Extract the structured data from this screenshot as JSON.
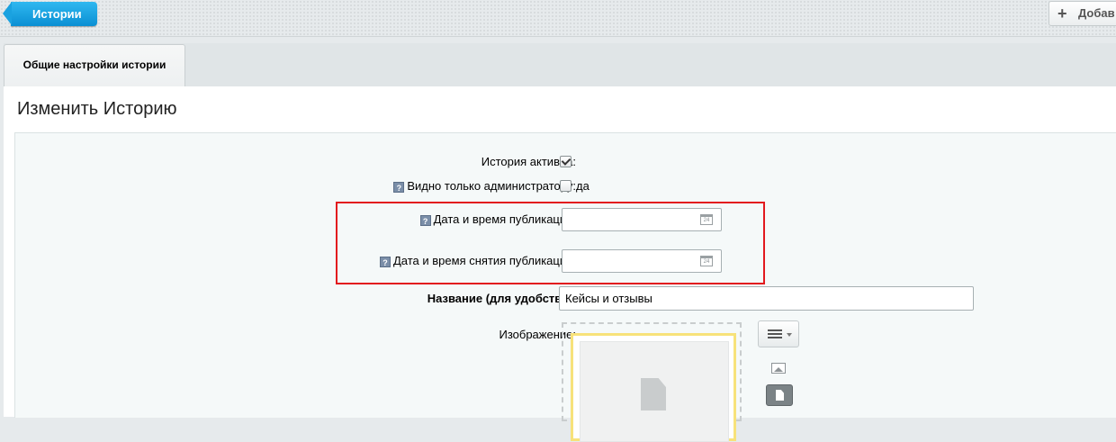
{
  "toolbar": {
    "back_label": "Истории",
    "add_label": "Добав"
  },
  "tabs": [
    {
      "label": "Общие настройки истории"
    }
  ],
  "page_title": "Изменить Историю",
  "form": {
    "active": {
      "label": "История активна:",
      "checked": true
    },
    "admin_only": {
      "label": "Видно только администратору:",
      "option_label": "да",
      "checked": false
    },
    "publish_date": {
      "label": "Дата и время публикации:",
      "value": ""
    },
    "unpublish_date": {
      "label": "Дата и время снятия публикации:",
      "value": ""
    },
    "name": {
      "label": "Название (для удобства):",
      "value": "Кейсы и отзывы"
    },
    "image": {
      "label": "Изображение:"
    }
  },
  "icons": {
    "hint": "?",
    "calendar": "24"
  },
  "colors": {
    "accent": "#0a8fd3",
    "highlight": "#e2191e",
    "drop_border": "#f7e27a"
  }
}
